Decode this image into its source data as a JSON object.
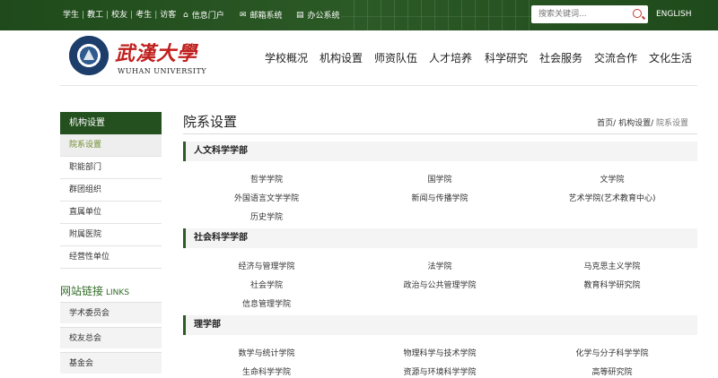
{
  "topbar": {
    "roles": [
      "学生",
      "教工",
      "校友",
      "考生",
      "访客"
    ],
    "nav": [
      {
        "icon": "home-icon",
        "glyph": "⌂",
        "label": "信息门户"
      },
      {
        "icon": "mail-icon",
        "glyph": "✉",
        "label": "邮箱系统"
      },
      {
        "icon": "office-icon",
        "glyph": "▤",
        "label": "办公系统"
      }
    ],
    "search_placeholder": "搜索关键词...",
    "english": "ENGLISH"
  },
  "header": {
    "logo_cn": "武漢大學",
    "logo_en": "WUHAN UNIVERSITY",
    "nav": [
      "学校概况",
      "机构设置",
      "师资队伍",
      "人才培养",
      "科学研究",
      "社会服务",
      "交流合作",
      "文化生活"
    ]
  },
  "sidebar": {
    "title": "机构设置",
    "items": [
      "院系设置",
      "职能部门",
      "群团组织",
      "直属单位",
      "附属医院",
      "经营性单位"
    ],
    "active_index": 0,
    "links_title": "网站链接",
    "links_title_en": "LINKS",
    "links": [
      "学术委员会",
      "校友总会",
      "基金会"
    ]
  },
  "main": {
    "title": "院系设置",
    "breadcrumb": [
      "首页",
      "机构设置",
      "院系设置"
    ],
    "sections": [
      {
        "name": "人文科学学部",
        "departments": [
          "哲学学院",
          "国学院",
          "文学院",
          "外国语言文学学院",
          "新闻与传播学院",
          "艺术学院(艺术教育中心)",
          "历史学院"
        ]
      },
      {
        "name": "社会科学学部",
        "departments": [
          "经济与管理学院",
          "法学院",
          "马克思主义学院",
          "社会学院",
          "政治与公共管理学院",
          "教育科学研究院",
          "信息管理学院"
        ]
      },
      {
        "name": "理学部",
        "departments": [
          "数学与统计学院",
          "物理科学与技术学院",
          "化学与分子科学学院",
          "生命科学学院",
          "资源与环境科学学院",
          "高等研究院"
        ]
      }
    ]
  },
  "colors": {
    "brand_green": "#24501f",
    "accent_red": "#c0201e",
    "active_text": "#6f8c2a"
  }
}
